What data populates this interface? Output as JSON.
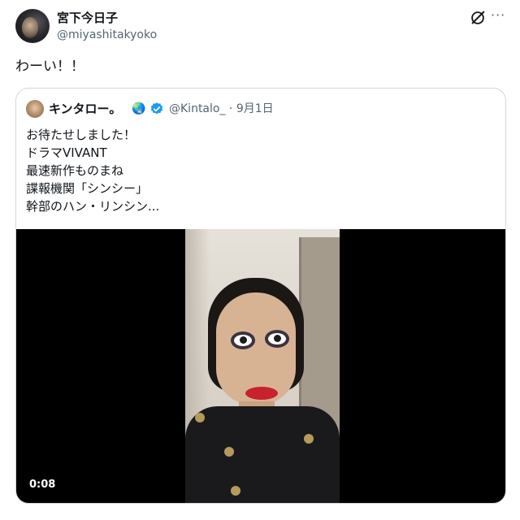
{
  "tweet": {
    "author_name": "宮下今日子",
    "author_handle": "@miyashitakyoko",
    "text": "わーい！！"
  },
  "icons": {
    "grok": "grok-icon",
    "more": "more-icon",
    "globe": "globe-icon",
    "verified": "verified-badge-icon"
  },
  "more_label": "···",
  "quote": {
    "author_name": "キンタロー。",
    "globe_glyph": "🌏",
    "handle_date": "@Kintalo_ · 9月1日",
    "lines": [
      "お待たせしました！",
      "ドラマVIVANT",
      "最速新作ものまね",
      "諜報機関「シンシー」",
      "幹部のハン・リンシン..."
    ],
    "video_time": "0:08"
  },
  "colors": {
    "text": "#0f1419",
    "secondary": "#536471",
    "border": "#cfd9de",
    "verified": "#1d9bf0"
  }
}
